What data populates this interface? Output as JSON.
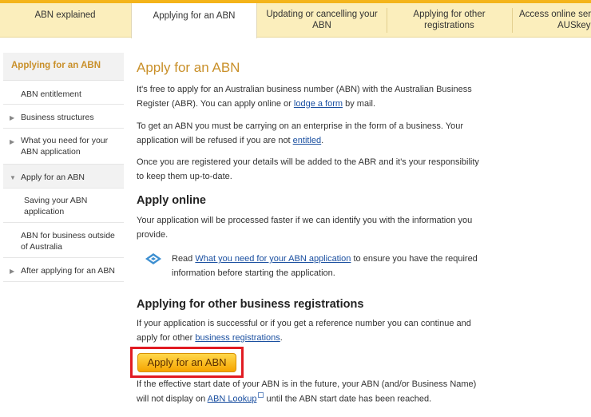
{
  "nav": {
    "tabs": [
      {
        "label": "ABN explained"
      },
      {
        "label": "Applying for an ABN"
      },
      {
        "label": "Updating or cancelling your ABN"
      },
      {
        "label": "Applying for other registrations"
      },
      {
        "label": "Access online serv AUSkey"
      }
    ],
    "tab3_line1": "Updating or cancelling your",
    "tab3_line2": "ABN",
    "tab4_line1": "Applying for other",
    "tab4_line2": "registrations",
    "tab5_line1": "Access online serv",
    "tab5_line2": "AUSkey"
  },
  "sidebar": {
    "heading": "Applying for an ABN",
    "items": [
      {
        "label": "ABN entitlement"
      },
      {
        "label": "Business structures"
      },
      {
        "label": "What you need for your ABN application"
      },
      {
        "label": "Apply for an ABN"
      },
      {
        "label": "Saving your ABN application"
      },
      {
        "label": "ABN for business outside of Australia"
      },
      {
        "label": "After applying for an ABN"
      }
    ]
  },
  "main": {
    "title": "Apply for an ABN",
    "p1_a": "It's free to apply for an Australian business number (ABN) with the Australian Business Register (ABR). You can apply online or ",
    "p1_link": "lodge a form",
    "p1_b": " by mail.",
    "p2_a": "To get an ABN you must be carrying on an enterprise in the form of a business. Your application will be refused if you are not ",
    "p2_link": "entitled",
    "p2_b": ".",
    "p3": "Once you are registered your details will be added to the ABR and it's your responsibility to keep them up-to-date.",
    "h_online": "Apply online",
    "p4": "Your application will be processed faster if we can identify you with the information you provide.",
    "info_a": "Read ",
    "info_link": "What you need for your ABN application",
    "info_b": " to ensure you have the required information before starting the application.",
    "h_other": "Applying for other business registrations",
    "p5_a": "If your application is successful or if you get a reference number you can continue and apply for other ",
    "p5_link": "business registrations",
    "p5_b": ".",
    "button": "Apply for an ABN",
    "p6_a": "If the effective start date of your ABN is in the future, your ABN (and/or Business Name) will not display on ",
    "p6_link": "ABN Lookup",
    "p6_b": "  until the ABN start date has been reached."
  },
  "colors": {
    "accent": "#c9902a",
    "nav_bg": "#fbeebc",
    "button_top": "#ffd84a",
    "button_bottom": "#f6a400",
    "highlight_frame": "#e11b22"
  }
}
